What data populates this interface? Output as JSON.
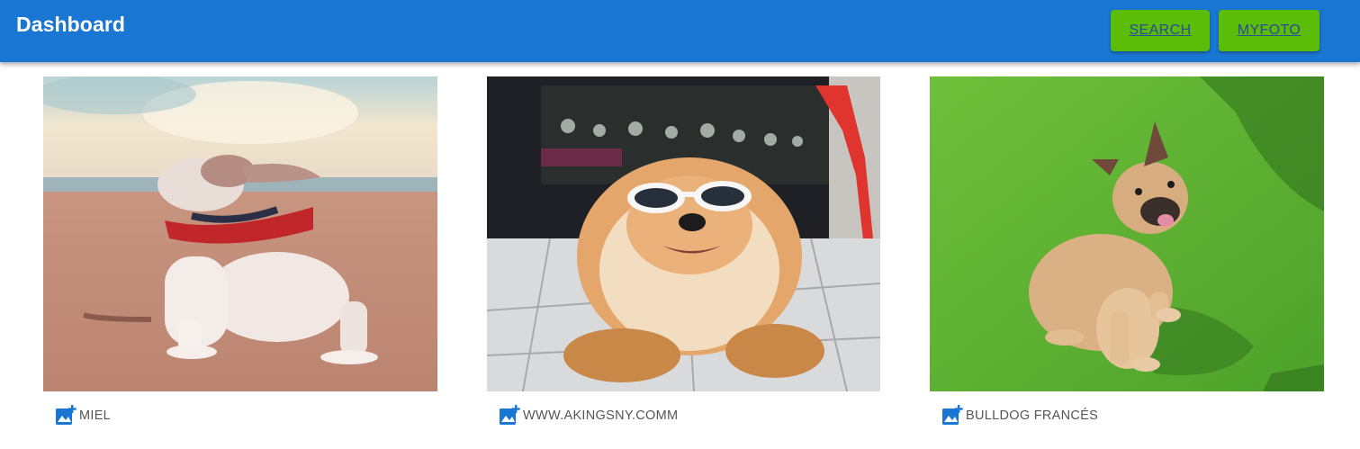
{
  "appbar": {
    "title": "Dashboard",
    "buttons": [
      {
        "label": "SEARCH"
      },
      {
        "label": "MYFOTO"
      }
    ]
  },
  "colors": {
    "appbar": "#1976d2",
    "button": "#5bbd07",
    "caption_icon": "#1976d2"
  },
  "gallery": [
    {
      "label": "MIEL",
      "image": "white-pitbull-puppy-red-bandana-on-beach-photo",
      "icon": "add-photo-icon"
    },
    {
      "label": "WWW.AKINGSNY.COMM",
      "image": "fluffy-chow-chow-dog-with-white-sunglasses-photo",
      "icon": "add-photo-icon"
    },
    {
      "label": "BULLDOG FRANCÉS",
      "image": "french-bulldog-sitting-on-grass-photo",
      "icon": "add-photo-icon"
    }
  ]
}
